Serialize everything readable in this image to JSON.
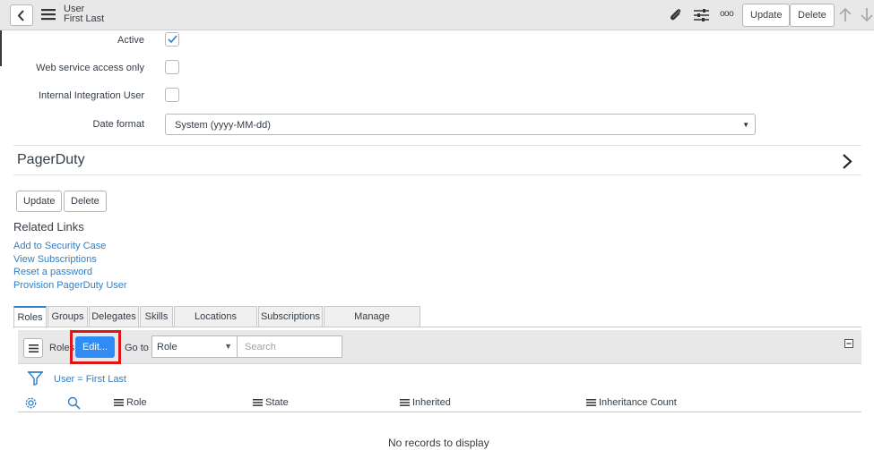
{
  "header": {
    "record_type": "User",
    "record_name": "First Last",
    "update_label": "Update",
    "delete_label": "Delete",
    "more_glyph": "ooo"
  },
  "form": {
    "active_label": "Active",
    "active_checked": true,
    "web_service_label": "Web service access only",
    "internal_integration_label": "Internal Integration User",
    "date_format_label": "Date format",
    "date_format_value": "System (yyyy-MM-dd)"
  },
  "section": {
    "title": "PagerDuty"
  },
  "form_buttons": {
    "update_label": "Update",
    "delete_label": "Delete"
  },
  "related_links": {
    "title": "Related Links",
    "links": [
      "Add to Security Case",
      "View Subscriptions",
      "Reset a password",
      "Provision PagerDuty User"
    ]
  },
  "tabs": [
    "Roles",
    "Groups",
    "Delegates",
    "Skills",
    "Locations Covered",
    "Subscriptions",
    "Manage Subscriptions"
  ],
  "list": {
    "title": "Roles",
    "edit_label": "Edit...",
    "goto_label": "Go to",
    "goto_value": "Role",
    "search_placeholder": "Search",
    "filter_text": "User = First Last",
    "columns": [
      "Role",
      "State",
      "Inherited",
      "Inheritance Count"
    ],
    "empty_message": "No records to display"
  },
  "colors": {
    "accent_blue": "#2f8cf5",
    "link_blue": "#2e7fc8",
    "highlight_red": "#e0151a"
  },
  "icons": [
    "chevron-left-icon",
    "hamburger-icon",
    "paperclip-icon",
    "settings-sliders-icon",
    "more-icon",
    "arrow-up-icon",
    "arrow-down-icon",
    "checkmark-icon",
    "chevron-right-icon",
    "filter-funnel-icon",
    "gear-icon",
    "search-icon",
    "collapse-icon"
  ]
}
